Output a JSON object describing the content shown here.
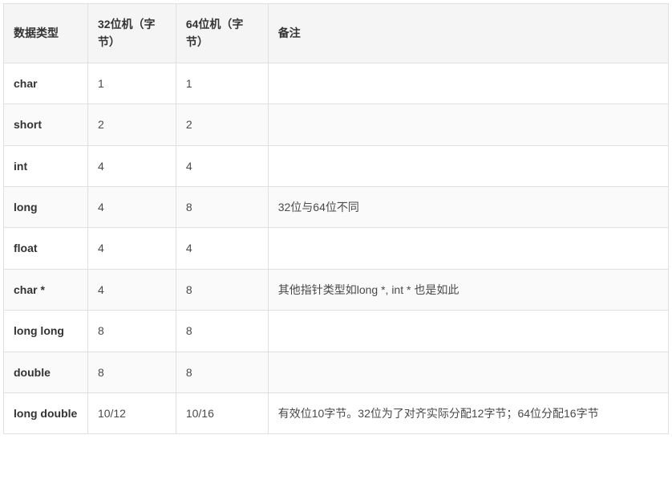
{
  "chart_data": {
    "type": "table",
    "headers": [
      "数据类型",
      "32位机（字节）",
      "64位机（字节）",
      "备注"
    ],
    "rows": [
      {
        "type": "char",
        "b32": "1",
        "b64": "1",
        "note": ""
      },
      {
        "type": "short",
        "b32": "2",
        "b64": "2",
        "note": ""
      },
      {
        "type": "int",
        "b32": "4",
        "b64": "4",
        "note": ""
      },
      {
        "type": "long",
        "b32": "4",
        "b64": "8",
        "note": "32位与64位不同"
      },
      {
        "type": "float",
        "b32": "4",
        "b64": "4",
        "note": ""
      },
      {
        "type": "char *",
        "b32": "4",
        "b64": "8",
        "note": "其他指针类型如long *, int * 也是如此"
      },
      {
        "type": "long long",
        "b32": "8",
        "b64": "8",
        "note": ""
      },
      {
        "type": "double",
        "b32": "8",
        "b64": "8",
        "note": ""
      },
      {
        "type": "long double",
        "b32": "10/12",
        "b64": "10/16",
        "note": "有效位10字节。32位为了对齐实际分配12字节；64位分配16字节"
      }
    ]
  }
}
